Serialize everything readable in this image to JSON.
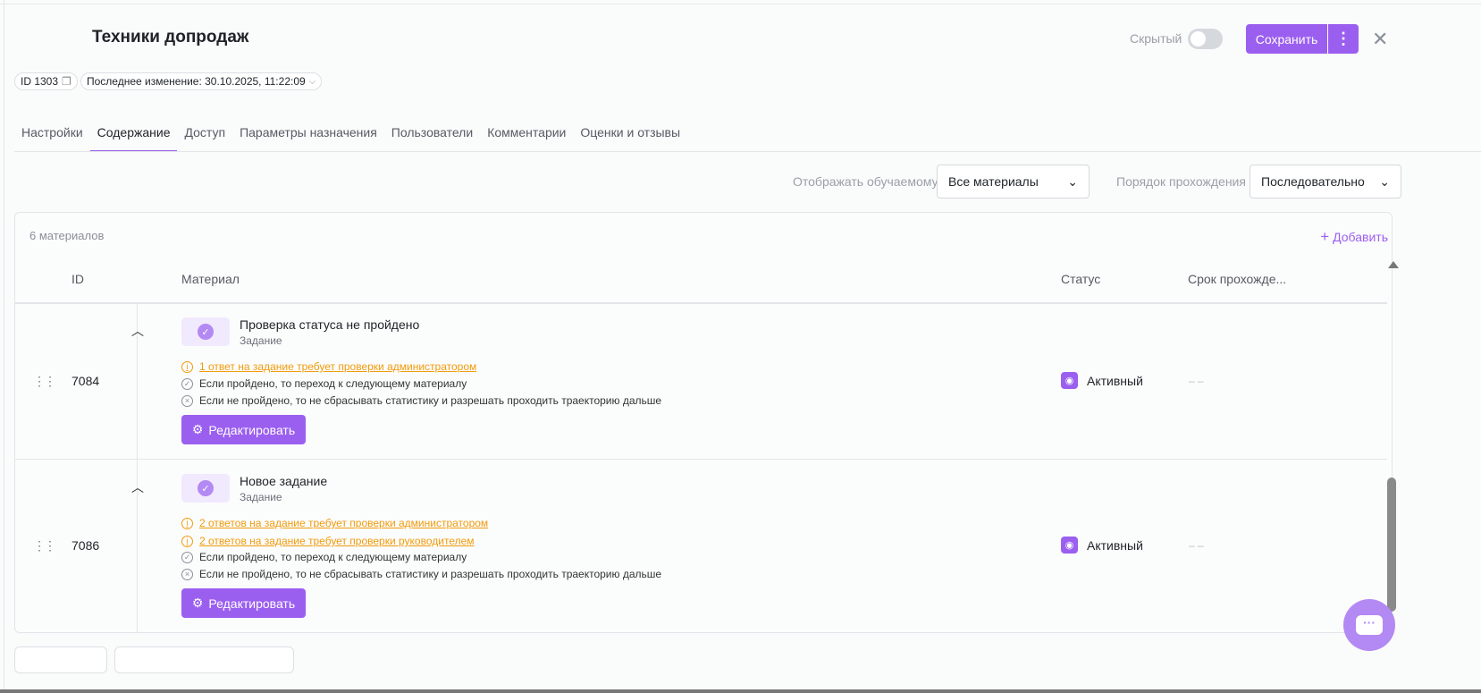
{
  "header": {
    "title": "Техники допродаж",
    "id_chip": "ID 1303",
    "last_change": "Последнее изменение: 30.10.2025, 11:22:09",
    "hidden_label": "Скрытый",
    "hidden_on": false,
    "save_label": "Сохранить",
    "more_label": "⋮",
    "close_label": "✕"
  },
  "tabs": [
    {
      "label": "Настройки"
    },
    {
      "label": "Содержание",
      "active": true
    },
    {
      "label": "Доступ"
    },
    {
      "label": "Параметры назначения"
    },
    {
      "label": "Пользователи"
    },
    {
      "label": "Комментарии"
    },
    {
      "label": "Оценки и отзывы"
    }
  ],
  "filters": {
    "display_label": "Отображать обучаемому",
    "display_value": "Все материалы",
    "order_label": "Порядок прохождения",
    "order_value": "Последовательно"
  },
  "table": {
    "count": "6 материалов",
    "add_label": "Добавить",
    "columns": [
      "ID",
      "Материал",
      "Статус",
      "Срок прохожде..."
    ],
    "rows": [
      {
        "id": "7084",
        "name": "Проверка статуса не пройдено",
        "type": "Задание",
        "warnings": [
          "1 ответ на задание требует проверки администратором"
        ],
        "pass": "Если пройдено, то переход к следующему материалу",
        "fail": "Если не пройдено, то не сбрасывать статистику и разрешать проходить траекторию дальше",
        "edit": "Редактировать",
        "status": "Активный",
        "deadline": "– –"
      },
      {
        "id": "7086",
        "name": "Новое задание",
        "type": "Задание",
        "warnings": [
          "2 ответов на задание требует проверки администратором",
          "2 ответов на задание требует проверки руководителем"
        ],
        "pass": "Если пройдено, то переход к следующему материалу",
        "fail": "Если не пройдено, то не сбрасывать статистику и разрешать проходить траекторию дальше",
        "edit": "Редактировать",
        "status": "Активный",
        "deadline": "– –"
      }
    ]
  },
  "colors": {
    "accent": "#9b5ff0",
    "warning": "#f29b0c"
  }
}
